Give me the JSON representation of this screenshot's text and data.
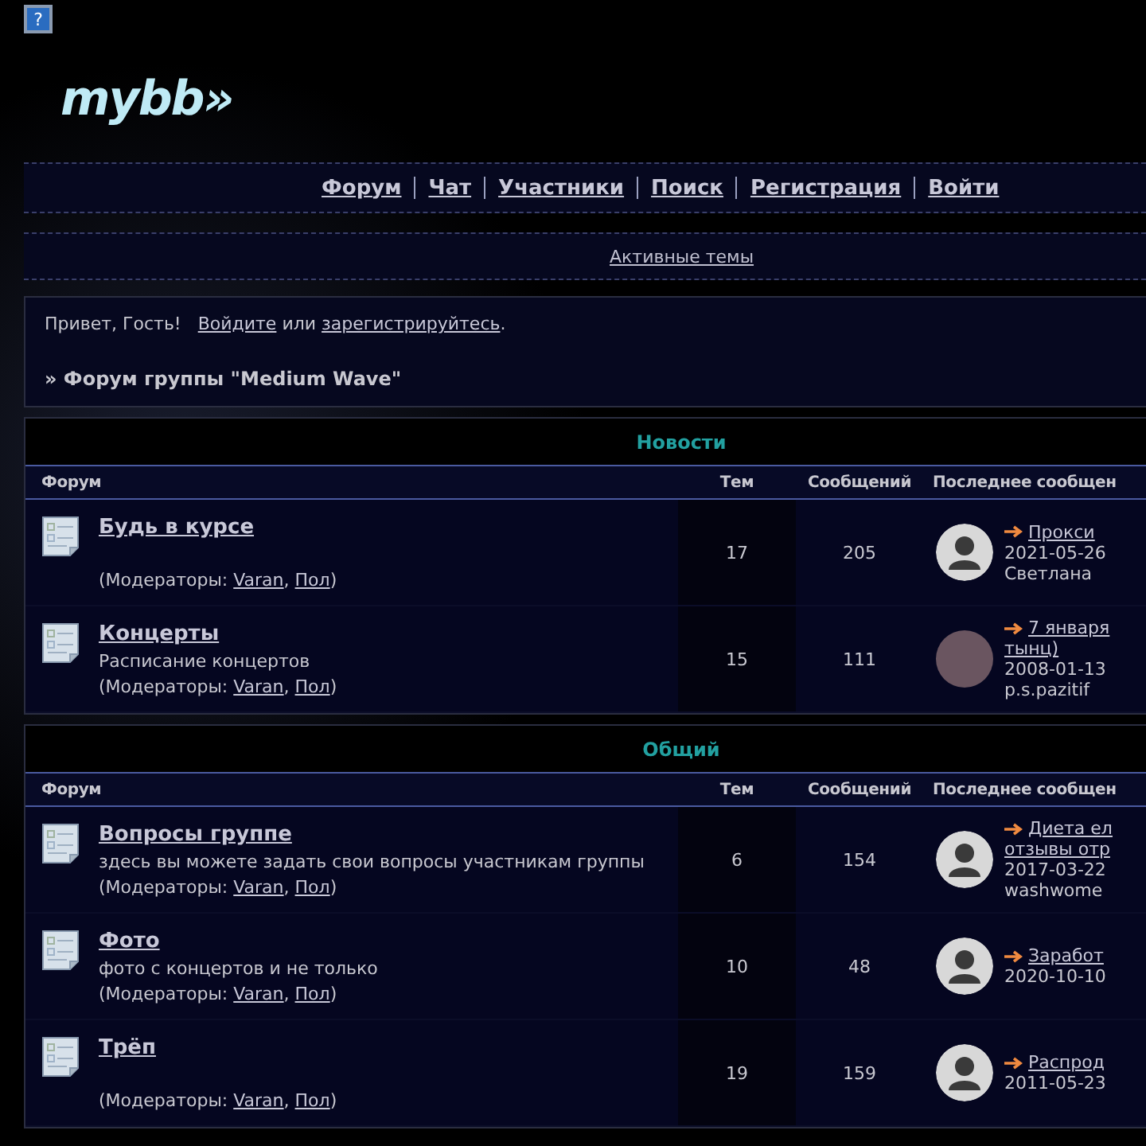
{
  "help_button": "?",
  "logo": "mybb»",
  "nav": [
    "Форум",
    "Чат",
    "Участники",
    "Поиск",
    "Регистрация",
    "Войти"
  ],
  "subnav": [
    "Активные темы"
  ],
  "welcome": {
    "greeting": "Привет, Гость!",
    "login": "Войдите",
    "or": "или",
    "register": "зарегистрируйтесь",
    "end": "."
  },
  "breadcrumb": "» Форум группы \"Medium Wave\"",
  "moderators_separator": ",",
  "moderators_suffix": ")",
  "categories": [
    {
      "title": "Новости",
      "columns": [
        "Форум",
        "Тем",
        "Сообщений",
        "Последнее сообщен"
      ],
      "forums": [
        {
          "name": "Будь в курсе",
          "moderators_label": "(Модераторы:",
          "moderators": [
            "Varan",
            "Пол"
          ],
          "topics": "17",
          "posts": "205",
          "last": {
            "kind": "default",
            "title_lines": [
              "Прокси"
            ],
            "date": "2021-05-26",
            "author": "Светлана"
          }
        },
        {
          "name": "Концерты",
          "description": "Расписание концертов",
          "moderators_label": "(Модераторы:",
          "moderators": [
            "Varan",
            "Пол"
          ],
          "topics": "15",
          "posts": "111",
          "last": {
            "kind": "photo",
            "title_lines": [
              "7 января",
              "тынц)"
            ],
            "date": "2008-01-13",
            "author": "p.s.pazitif"
          }
        }
      ]
    },
    {
      "title": "Общий",
      "columns": [
        "Форум",
        "Тем",
        "Сообщений",
        "Последнее сообщен"
      ],
      "forums": [
        {
          "name": "Вопросы группе",
          "description": "здесь вы можете задать свои вопросы участникам группы",
          "moderators_label": "(Модераторы:",
          "moderators": [
            "Varan",
            "Пол"
          ],
          "topics": "6",
          "posts": "154",
          "last": {
            "kind": "default",
            "title_lines": [
              "Диета ел",
              "отзывы отр"
            ],
            "date": "2017-03-22",
            "author": "washwome"
          }
        },
        {
          "name": "Фото",
          "description": "фото с концертов и не только",
          "moderators_label": "(Модераторы:",
          "moderators": [
            "Varan",
            "Пол"
          ],
          "topics": "10",
          "posts": "48",
          "last": {
            "kind": "default",
            "title_lines": [
              "Заработ"
            ],
            "date": "2020-10-10"
          }
        },
        {
          "name": "Трёп",
          "moderators_label": "(Модераторы:",
          "moderators": [
            "Varan",
            "Пол"
          ],
          "topics": "19",
          "posts": "159",
          "last": {
            "kind": "default",
            "title_lines": [
              "Распрод"
            ],
            "date": "2011-05-23"
          }
        }
      ]
    }
  ]
}
